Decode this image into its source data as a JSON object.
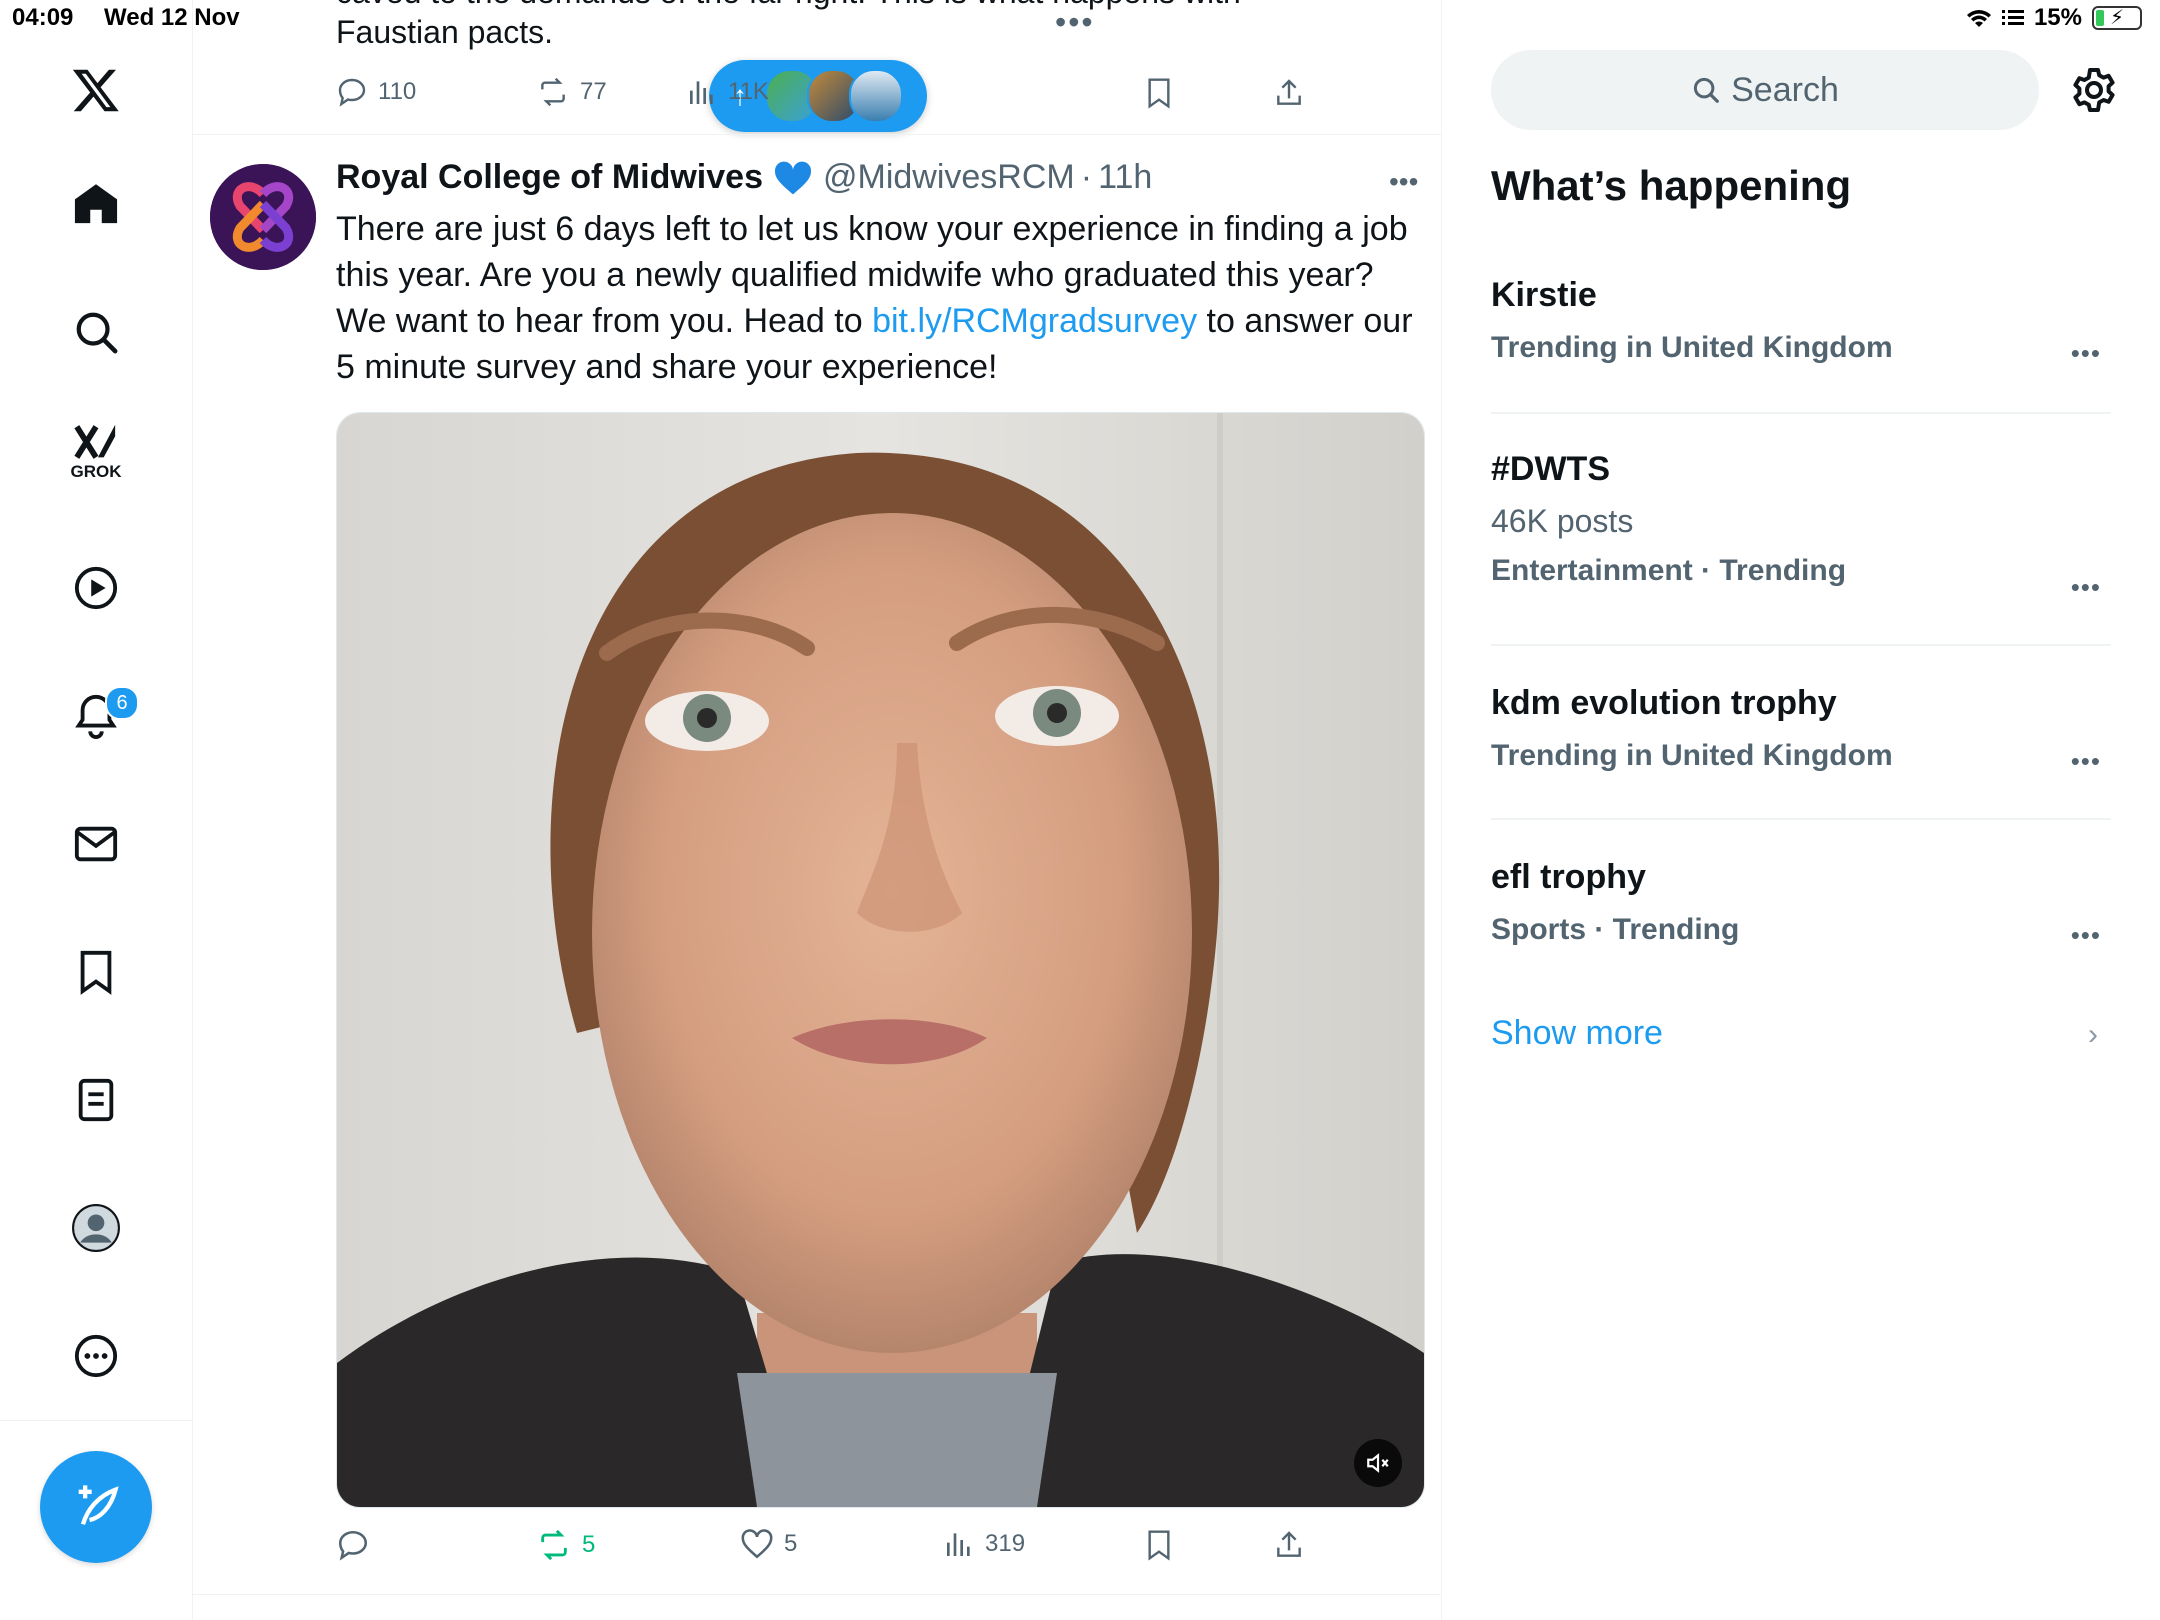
{
  "status_bar": {
    "time": "04:09",
    "date": "Wed 12 Nov",
    "battery": "15%"
  },
  "nav": {
    "grok_label": "GROK",
    "notification_count": "6"
  },
  "previous_post": {
    "text_cut": "caved to the demands of the far right. This is what happens with",
    "text": "Faustian pacts.",
    "replies": "110",
    "reposts": "77",
    "views": "11K"
  },
  "post": {
    "author_name": "Royal College of Midwives",
    "handle": "@MidwivesRCM",
    "separator": "·",
    "time": "11h",
    "body_before": "There are just 6 days left to let us know your experience in finding a job this year. Are you a newly qualified midwife who graduated this year? We want to hear from you. Head to ",
    "link": "bit.ly/RCMgradsurvey",
    "body_after": " to answer our 5 minute survey and share your experience!",
    "replies": "",
    "reposts": "5",
    "likes": "5",
    "views": "319"
  },
  "sidebar": {
    "search_placeholder": "Search",
    "section_title": "What’s happening",
    "trends": [
      {
        "title": "Kirstie",
        "meta": "Trending in United Kingdom",
        "posts": ""
      },
      {
        "title": "#DWTS",
        "posts": "46K posts",
        "meta": "Entertainment · Trending"
      },
      {
        "title": "kdm evolution trophy",
        "meta": "Trending in United Kingdom",
        "posts": ""
      },
      {
        "title": "efl trophy",
        "meta": "Sports · Trending",
        "posts": ""
      }
    ],
    "show_more": "Show more"
  },
  "colors": {
    "accent": "#1d9bf0",
    "repost_green": "#00ba7c",
    "secondary_text": "#536471"
  }
}
